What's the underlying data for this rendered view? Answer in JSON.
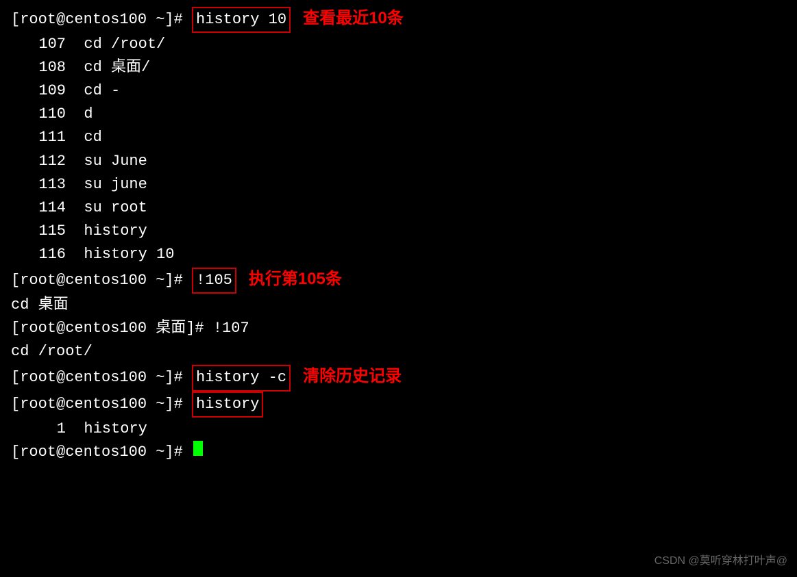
{
  "terminal": {
    "lines": [
      {
        "id": "line1",
        "type": "prompt_command",
        "prompt": "[root@centos100 ~]# ",
        "command": "history 10",
        "highlighted": true,
        "annotation": "查看最近10条"
      },
      {
        "id": "line2",
        "type": "history_item",
        "num": "107",
        "cmd": "cd /root/"
      },
      {
        "id": "line3",
        "type": "history_item",
        "num": "108",
        "cmd": "cd 桌面/"
      },
      {
        "id": "line4",
        "type": "history_item",
        "num": "109",
        "cmd": "cd -"
      },
      {
        "id": "line5",
        "type": "history_item",
        "num": "110",
        "cmd": "d"
      },
      {
        "id": "line6",
        "type": "history_item",
        "num": "111",
        "cmd": "cd"
      },
      {
        "id": "line7",
        "type": "history_item",
        "num": "112",
        "cmd": "su June"
      },
      {
        "id": "line8",
        "type": "history_item",
        "num": "113",
        "cmd": "su june"
      },
      {
        "id": "line9",
        "type": "history_item",
        "num": "114",
        "cmd": "su root"
      },
      {
        "id": "line10",
        "type": "history_item",
        "num": "115",
        "cmd": "history"
      },
      {
        "id": "line11",
        "type": "history_item",
        "num": "116",
        "cmd": "history 10"
      },
      {
        "id": "line12",
        "type": "prompt_command",
        "prompt": "[root@centos100 ~]# ",
        "command": "!105",
        "highlighted": true,
        "annotation": "执行第105条"
      },
      {
        "id": "line13",
        "type": "output",
        "text": "cd 桌面"
      },
      {
        "id": "line14",
        "type": "prompt_command",
        "prompt": "[root@centos100 桌面]# ",
        "command": "!107",
        "highlighted": false,
        "annotation": ""
      },
      {
        "id": "line15",
        "type": "output",
        "text": "cd /root/"
      },
      {
        "id": "line16",
        "type": "prompt_command",
        "prompt": "[root@centos100 ~]# ",
        "command": "history -c",
        "highlighted": true,
        "annotation": "清除历史记录"
      },
      {
        "id": "line17",
        "type": "prompt_command",
        "prompt": "[root@centos100 ~]# ",
        "command": "history",
        "highlighted": true,
        "annotation": ""
      },
      {
        "id": "line18",
        "type": "history_item",
        "num": "1",
        "cmd": "history"
      },
      {
        "id": "line19",
        "type": "prompt_cursor",
        "prompt": "[root@centos100 ~]# "
      }
    ],
    "watermark": "CSDN @莫听穿林打叶声@"
  }
}
